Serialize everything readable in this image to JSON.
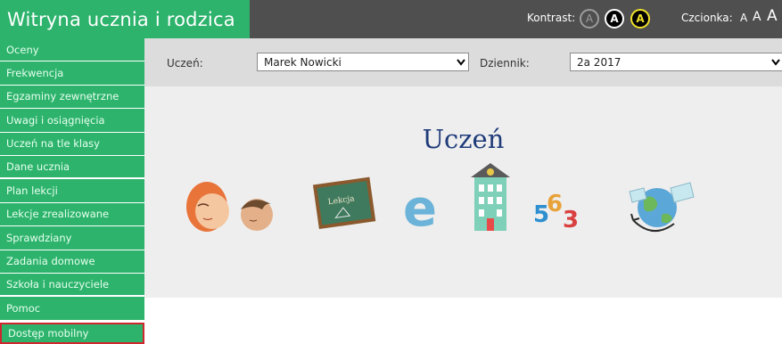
{
  "header": {
    "app_title": "Witryna ucznia i rodzica",
    "contrast_label": "Kontrast:",
    "contrast_options": [
      "A",
      "A",
      "A"
    ],
    "font_label": "Czcionka:",
    "font_sizes": [
      "A",
      "A",
      "A"
    ]
  },
  "sidebar": {
    "items": [
      {
        "label": "Oceny"
      },
      {
        "label": "Frekwencja"
      },
      {
        "label": "Egzaminy zewnętrzne"
      },
      {
        "label": "Uwagi i osiągnięcia"
      },
      {
        "label": "Uczeń na tle klasy"
      },
      {
        "label": "Dane ucznia"
      },
      {
        "label": "Plan lekcji"
      },
      {
        "label": "Lekcje zrealizowane"
      },
      {
        "label": "Sprawdziany"
      },
      {
        "label": "Zadania domowe"
      },
      {
        "label": "Szkoła i nauczyciele"
      },
      {
        "label": "Pomoc"
      },
      {
        "label": "Dostęp mobilny"
      }
    ]
  },
  "filters": {
    "student_label": "Uczeń:",
    "student_value": "Marek Nowicki",
    "journal_label": "Dziennik:",
    "journal_value": "2a 2017"
  },
  "banner": {
    "title": "Uczeń",
    "chalkboard_text": "Lekcja",
    "numbers_text": [
      "5",
      "6",
      "3"
    ]
  },
  "colors": {
    "brand_green": "#2db36c",
    "header_dark": "#4f4f4f",
    "highlight_border": "#d0262d",
    "title_blue": "#1f3b7a"
  }
}
